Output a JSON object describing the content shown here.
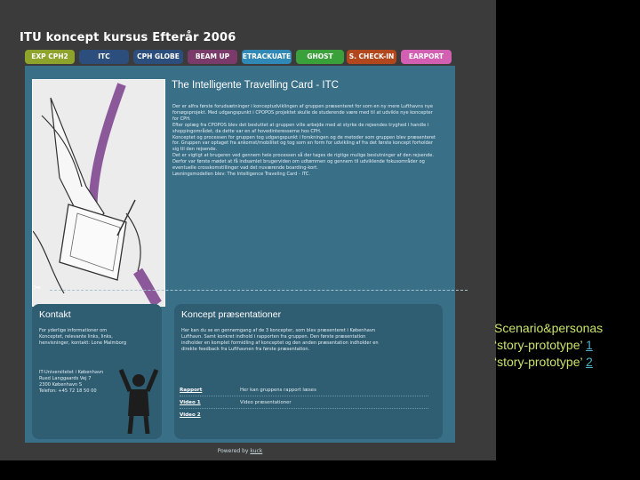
{
  "site": {
    "title": "ITU koncept kursus Efterår 2006"
  },
  "tabs": [
    {
      "label": "EXP CPH2",
      "color": "#8ea32c"
    },
    {
      "label": "ITC",
      "color": "#2b4e7c"
    },
    {
      "label": "CPH GLOBE",
      "color": "#2b4e7c"
    },
    {
      "label": "BEAM UP",
      "color": "#7a3a6a"
    },
    {
      "label": "ETRACKUATE",
      "color": "#2f88b5"
    },
    {
      "label": "GHOST",
      "color": "#3aa03a"
    },
    {
      "label": "S. CHECK-IN",
      "color": "#b2461c"
    },
    {
      "label": "EARPORT",
      "color": "#d35fb3"
    }
  ],
  "hero": {
    "title": "The Intelligente Travelling Card - ITC",
    "body": [
      "Der er alfra første forudsætninger i konceptudviklingen af gruppen præsenteret for som en ny mere Lufthavns nye forsøgsprojekt. Med udgangspunkt i CPOPOS projektet skulle de studerende være med til at udvikle nye koncepter for CPH.",
      "Efter oplæg fra CPOPOS blev det besluttet at gruppen ville arbejde med at styrke de rejsendes tryghed i handle i shoppingområdet, da dette var en af hovedinteresserne hos CPH.",
      "Konceptet og processen for gruppen tog udgangspunkt i forskningen og de metoder som gruppen blev præsenteret for. Gruppen var optaget fra ankomst/mobilitet og tog som en form for udvikling af fra det første koncept forholder sig til den rejsende.",
      "Det er vigtigt at brugeren ved gennem hele processen så der tages de rigtige mulige beslutninger af den rejsende. Derfor var første mødet at få indsamlet brugerviden om udtømmen og gennem til udviklende fokusområder og eventuelle crosskomstillinger vad det nuværende boarding-kort.",
      "Løsningsmodellen blev: The Intelligence Traveling Card - ITC."
    ]
  },
  "kontakt": {
    "title": "Kontakt",
    "text": "For yderlige informationer om Konceptet, relevante links, links, henvisninger, kontakt: Lone Malmborg",
    "address": [
      "IT-Universitetet i København",
      "Rued Langgaards Vej 7",
      "2300 København S",
      "Telefon: +45 72 18 50 00"
    ]
  },
  "koncept": {
    "title": "Koncept præsentationer",
    "text": "Her kan du se en gennemgang af de 3 koncepter, som blev præsenteret i København Lufthavn. Samt konkret indhold i rapporten fra gruppen. Den første præsentation indholder en komplet formidling af konceptet og den anden præsentation indholder en direkte feedback fra Lufthavnen fra første præsentation.",
    "links": [
      {
        "label": "Rapport",
        "desc": "Her kan gruppens rapport læses"
      },
      {
        "label": "Video 1",
        "desc": "Video præsentationer"
      },
      {
        "label": "Video 2",
        "desc": ""
      }
    ]
  },
  "footer": {
    "prefix": "Powered by",
    "link": "kuck"
  },
  "notes": {
    "line1": "Scenario&personas",
    "line2_prefix": "‘story-prototype’",
    "line2_link": "1",
    "line3_prefix": "‘story-prototype’",
    "line3_link": "2"
  }
}
